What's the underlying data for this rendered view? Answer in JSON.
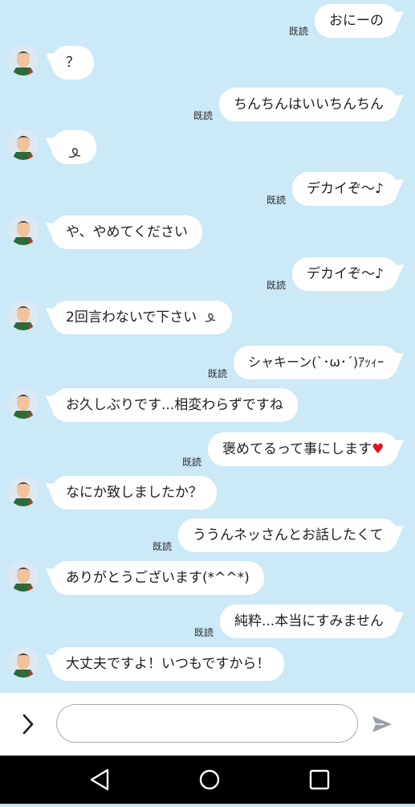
{
  "read_label": "既読",
  "messages": [
    {
      "side": "right",
      "text": "おにーの"
    },
    {
      "side": "left",
      "text": "？"
    },
    {
      "side": "right",
      "text": "ちんちんはいいちんちん"
    },
    {
      "side": "left",
      "text": "",
      "icon": "squiggle-icon"
    },
    {
      "side": "right",
      "text": "デカイぞ〜♪"
    },
    {
      "side": "left",
      "text": "や、やめてください"
    },
    {
      "side": "right",
      "text": "デカイぞ〜♪"
    },
    {
      "side": "left",
      "text": "2回言わないで下さい",
      "icon": "squiggle-icon"
    },
    {
      "side": "right",
      "text": "シャキーン(`･ω･´)ｱｯｨｰ"
    },
    {
      "side": "left",
      "text": "お久しぶりです...相変わらずですね"
    },
    {
      "side": "right",
      "text": "褒めてるって事にします",
      "heart": "♥"
    },
    {
      "side": "left",
      "text": "なにか致しましたか？"
    },
    {
      "side": "right",
      "text": "ううんネッさんとお話したくて"
    },
    {
      "side": "left",
      "text": "ありがとうございます(*^^*)"
    },
    {
      "side": "right",
      "text": "純粋...本当にすみません"
    },
    {
      "side": "left",
      "text": "大丈夫ですよ！いつもですから！"
    }
  ],
  "input": {
    "value": "",
    "placeholder": ""
  },
  "icons": {
    "expand": "chevron-right-icon",
    "send": "send-icon",
    "back": "back-triangle-icon",
    "home": "home-circle-icon",
    "recents": "recents-square-icon"
  },
  "colors": {
    "background": "#cbe9f6",
    "bubble": "#ffffff",
    "heart": "#e0121e",
    "navbar": "#000000"
  }
}
